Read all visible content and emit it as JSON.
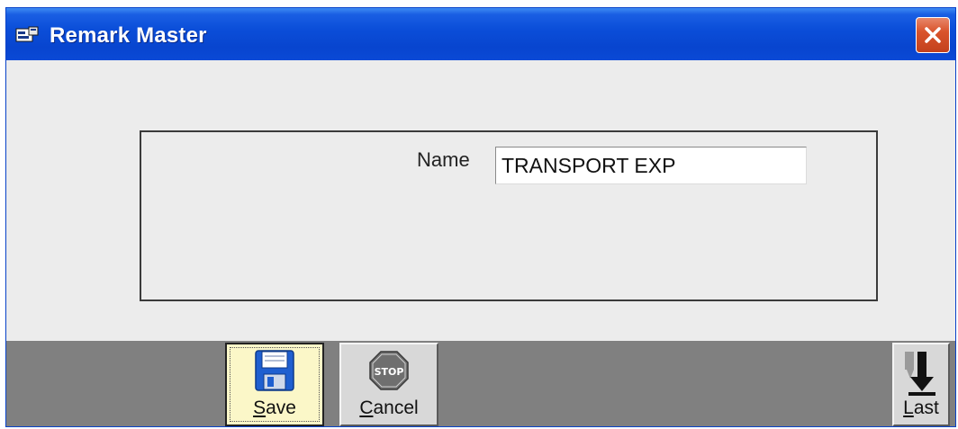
{
  "window": {
    "title": "Remark Master",
    "title_icon": "form-icon",
    "close_icon": "close-icon"
  },
  "form": {
    "name_label": "Name",
    "name_value": "TRANSPORT EXP"
  },
  "toolbar": {
    "save": {
      "accel": "S",
      "rest": "ave",
      "icon": "floppy-disk-icon"
    },
    "cancel": {
      "accel": "C",
      "rest": "ancel",
      "icon": "stop-sign-icon",
      "icon_text": "STOP"
    },
    "last": {
      "accel": "L",
      "rest": "ast",
      "icon": "arrow-down-last-icon"
    }
  },
  "colors": {
    "titlebar": "#0b4ed9",
    "close_button": "#d9542c",
    "dialog_bg": "#ececec",
    "toolbar_bg": "#808080",
    "save_highlight": "#fbf7c8"
  }
}
